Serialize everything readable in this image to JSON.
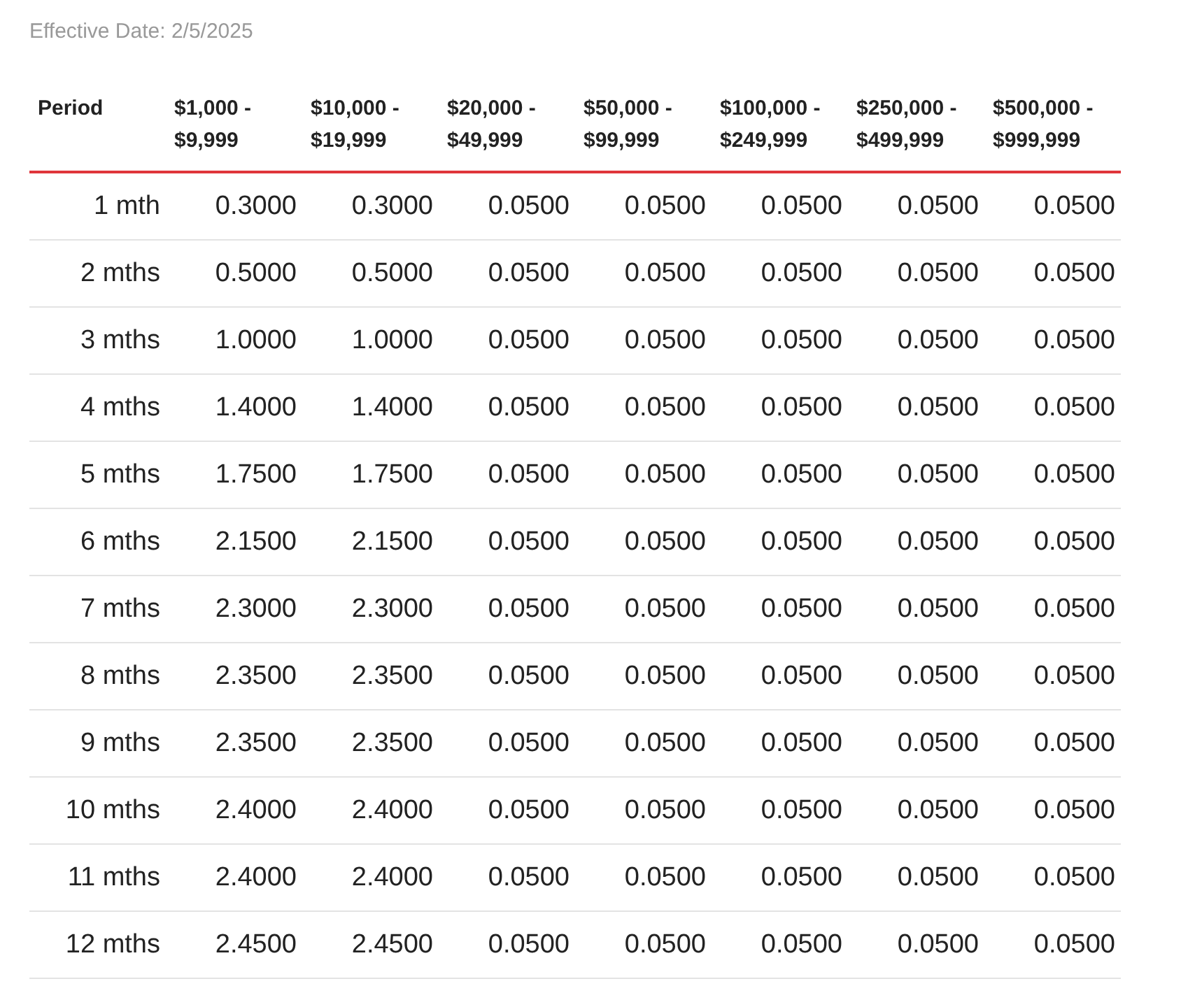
{
  "effective_date": "Effective Date: 2/5/2025",
  "table": {
    "columns": [
      "Period",
      "$1,000 - $9,999",
      "$10,000 - $19,999",
      "$20,000 - $49,999",
      "$50,000 - $99,999",
      "$100,000 - $249,999",
      "$250,000 - $499,999",
      "$500,000 - $999,999"
    ],
    "rows": [
      [
        "1 mth",
        "0.3000",
        "0.3000",
        "0.0500",
        "0.0500",
        "0.0500",
        "0.0500",
        "0.0500"
      ],
      [
        "2 mths",
        "0.5000",
        "0.5000",
        "0.0500",
        "0.0500",
        "0.0500",
        "0.0500",
        "0.0500"
      ],
      [
        "3 mths",
        "1.0000",
        "1.0000",
        "0.0500",
        "0.0500",
        "0.0500",
        "0.0500",
        "0.0500"
      ],
      [
        "4 mths",
        "1.4000",
        "1.4000",
        "0.0500",
        "0.0500",
        "0.0500",
        "0.0500",
        "0.0500"
      ],
      [
        "5 mths",
        "1.7500",
        "1.7500",
        "0.0500",
        "0.0500",
        "0.0500",
        "0.0500",
        "0.0500"
      ],
      [
        "6 mths",
        "2.1500",
        "2.1500",
        "0.0500",
        "0.0500",
        "0.0500",
        "0.0500",
        "0.0500"
      ],
      [
        "7 mths",
        "2.3000",
        "2.3000",
        "0.0500",
        "0.0500",
        "0.0500",
        "0.0500",
        "0.0500"
      ],
      [
        "8 mths",
        "2.3500",
        "2.3500",
        "0.0500",
        "0.0500",
        "0.0500",
        "0.0500",
        "0.0500"
      ],
      [
        "9 mths",
        "2.3500",
        "2.3500",
        "0.0500",
        "0.0500",
        "0.0500",
        "0.0500",
        "0.0500"
      ],
      [
        "10 mths",
        "2.4000",
        "2.4000",
        "0.0500",
        "0.0500",
        "0.0500",
        "0.0500",
        "0.0500"
      ],
      [
        "11 mths",
        "2.4000",
        "2.4000",
        "0.0500",
        "0.0500",
        "0.0500",
        "0.0500",
        "0.0500"
      ],
      [
        "12 mths",
        "2.4500",
        "2.4500",
        "0.0500",
        "0.0500",
        "0.0500",
        "0.0500",
        "0.0500"
      ]
    ]
  }
}
